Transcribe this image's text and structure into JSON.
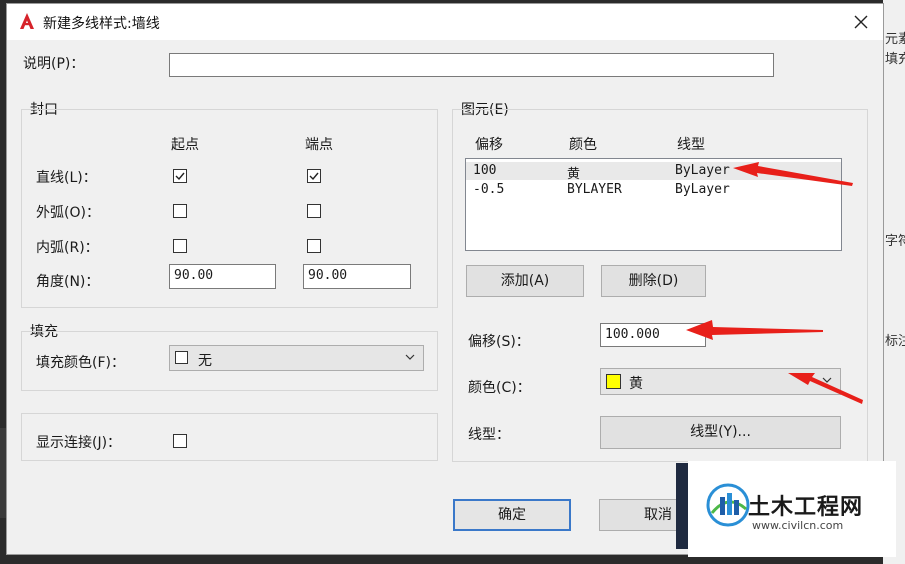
{
  "window": {
    "title": "新建多线样式:墙线",
    "close_glyph": "✕"
  },
  "background_fragments": [
    "元素",
    "填充",
    "字符",
    "标注"
  ],
  "description": {
    "label": "说明(P)：",
    "value": ""
  },
  "caps": {
    "group_title": "封口",
    "col_start": "起点",
    "col_end": "端点",
    "rows": [
      {
        "label": "直线(L)：",
        "start": true,
        "end": true
      },
      {
        "label": "外弧(O)：",
        "start": false,
        "end": false
      },
      {
        "label": "内弧(R)：",
        "start": false,
        "end": false
      }
    ],
    "angle": {
      "label": "角度(N)：",
      "start": "90.00",
      "end": "90.00"
    }
  },
  "fill": {
    "group_title": "填充",
    "label": "填充颜色(F)：",
    "value": "无",
    "swatch_color": "#ffffff"
  },
  "show_joints": {
    "label": "显示连接(J)：",
    "checked": false
  },
  "elements": {
    "group_title": "图元(E)",
    "headers": {
      "offset": "偏移",
      "color": "颜色",
      "linetype": "线型"
    },
    "rows": [
      {
        "offset": "100",
        "color": "黄",
        "linetype": "ByLayer"
      },
      {
        "offset": "-0.5",
        "color": "BYLAYER",
        "linetype": "ByLayer"
      }
    ],
    "add_label": "添加(A)",
    "delete_label": "删除(D)",
    "offset_label": "偏移(S)：",
    "offset_value": "100.000",
    "color_label": "颜色(C)：",
    "color_value": "黄",
    "color_swatch": "#ffff00",
    "linetype_label": "线型：",
    "linetype_button": "线型(Y)..."
  },
  "footer": {
    "ok_label": "确定",
    "cancel_label": "取消"
  },
  "watermark": {
    "cn": "土木工程网",
    "url": "www.civilcn.com"
  },
  "colors": {
    "accent_blue": "#3a78c9",
    "arrow_red": "#e8201a",
    "autocad_red": "#d6232a"
  }
}
